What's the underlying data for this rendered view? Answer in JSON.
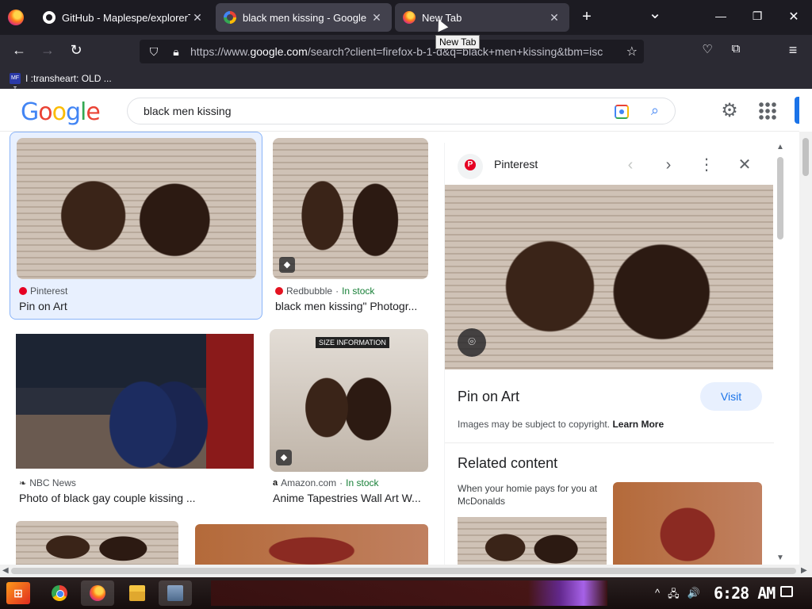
{
  "browser": {
    "tabs": [
      {
        "title": "GitHub - Maplespe/explorerT",
        "icon": "github-icon"
      },
      {
        "title": "black men kissing - Google Se",
        "icon": "google-icon"
      },
      {
        "title": "New Tab",
        "icon": "firefox-icon"
      }
    ],
    "new_tab_symbol": "+",
    "list_tabs_symbol": "⌄",
    "tooltip": "New Tab",
    "window_controls": {
      "minimize": "—",
      "restore": "❐",
      "close": "✕"
    },
    "url_prefix": "https://www.",
    "url_domain": "google.com",
    "url_rest": "/search?client=firefox-b-1-d&q=black+men+kissing&tbm=isc",
    "bookmark": {
      "badge": "MF T",
      "label": "I :transheart: OLD ..."
    }
  },
  "google": {
    "logo_letters": [
      {
        "ch": "G",
        "color": "#4285f4"
      },
      {
        "ch": "o",
        "color": "#ea4335"
      },
      {
        "ch": "o",
        "color": "#fbbc05"
      },
      {
        "ch": "g",
        "color": "#4285f4"
      },
      {
        "ch": "l",
        "color": "#34a853"
      },
      {
        "ch": "e",
        "color": "#ea4335"
      }
    ],
    "query": "black men kissing"
  },
  "results": [
    {
      "source": "Pinterest",
      "title": "Pin on Art",
      "stock": ""
    },
    {
      "source": "Redbubble",
      "title": "black men kissing\" Photogr...",
      "stock": "In stock"
    },
    {
      "source": "NBC News",
      "title": "Photo of black gay couple kissing ...",
      "stock": ""
    },
    {
      "source": "Amazon.com",
      "title": "Anime Tapestries Wall Art W...",
      "stock": "In stock",
      "overlay": "SIZE INFORMATION"
    }
  ],
  "stock_separator": "·",
  "panel": {
    "source": "Pinterest",
    "title": "Pin on Art",
    "visit_label": "Visit",
    "copyright": "Images may be subject to copyright.",
    "learn_more": "Learn More",
    "related_heading": "Related content",
    "related_caption": "When your homie pays for you at McDonalds"
  },
  "taskbar": {
    "clock": "6:28 AM",
    "tray": [
      "^",
      "🖧",
      "🔊"
    ]
  },
  "colors": {
    "accent": "#1a73e8",
    "stock_green": "#188038",
    "pinterest_red": "#e60023"
  }
}
